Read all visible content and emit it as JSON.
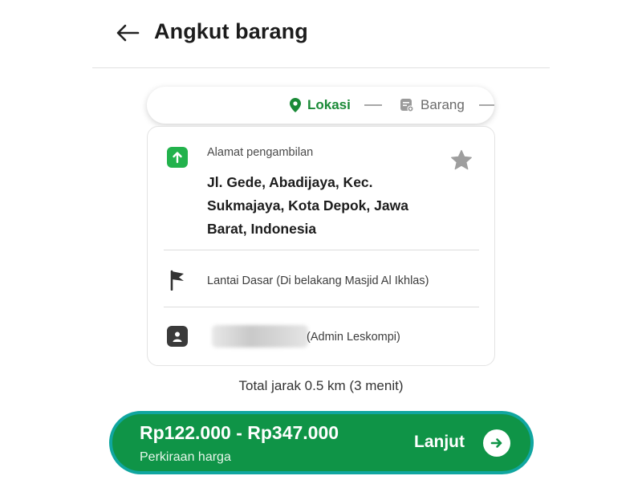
{
  "header": {
    "title": "Angkut barang",
    "back_icon": "arrow-left-icon"
  },
  "stepper": {
    "steps": [
      {
        "label": "Lokasi",
        "icon": "location-pin-icon",
        "active": true,
        "color": "#1a8a37"
      },
      {
        "label": "Barang",
        "icon": "package-icon",
        "active": false,
        "color": "#6b6b6b"
      }
    ]
  },
  "pickup": {
    "label": "Alamat pengambilan",
    "address": "Jl. Gede, Abadijaya, Kec. Sukmajaya, Kota Depok, Jawa Barat, Indonesia",
    "icon": "pickup-arrow-icon",
    "favorite_icon": "star-icon"
  },
  "note": {
    "text": "Lantai Dasar (Di belakang Masjid Al Ikhlas)",
    "icon": "flag-icon"
  },
  "contact": {
    "name": "(Admin Leskompi)",
    "icon": "contact-icon"
  },
  "summary": {
    "distance": "Total jarak 0.5 km (3 menit)"
  },
  "cta": {
    "price_range": "Rp122.000 - Rp347.000",
    "price_caption": "Perkiraan harga",
    "label": "Lanjut",
    "icon": "arrow-right-circle-icon"
  },
  "colors": {
    "brand_green": "#0f9447",
    "accent_green": "#22b24c",
    "border_teal": "#10a6a0"
  }
}
